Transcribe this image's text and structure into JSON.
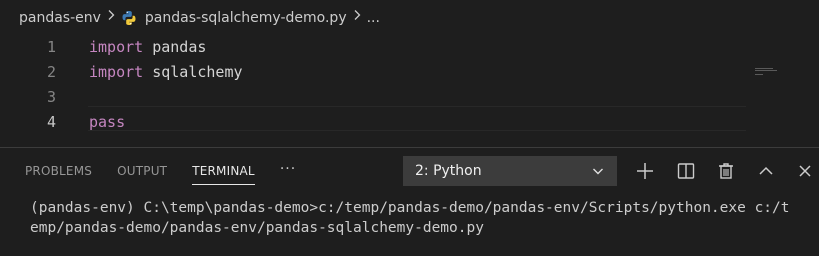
{
  "breadcrumb": {
    "folder": "pandas-env",
    "file": "pandas-sqlalchemy-demo.py",
    "more": "...",
    "separator": ">"
  },
  "editor": {
    "lines": [
      {
        "num": "1",
        "keyword": "import",
        "rest": " pandas"
      },
      {
        "num": "2",
        "keyword": "import",
        "rest": " sqlalchemy"
      },
      {
        "num": "3",
        "keyword": "",
        "rest": ""
      },
      {
        "num": "4",
        "keyword": "pass",
        "rest": ""
      }
    ]
  },
  "panel": {
    "tabs": [
      {
        "label": "PROBLEMS",
        "active": false
      },
      {
        "label": "OUTPUT",
        "active": false
      },
      {
        "label": "TERMINAL",
        "active": true
      }
    ],
    "more_label": "···",
    "terminal_select": {
      "value": "2: Python"
    },
    "actions": [
      "plus-icon",
      "split-terminal-icon",
      "trash-icon",
      "chevron-up-icon",
      "close-icon"
    ],
    "terminal_output": [
      "(pandas-env) C:\\temp\\pandas-demo>c:/temp/pandas-demo/pandas-env/Scripts/python.exe c:/t",
      "emp/pandas-demo/pandas-env/pandas-sqlalchemy-demo.py"
    ]
  },
  "colors": {
    "background": "#1e1e1e",
    "keyword": "#c586c0",
    "line_number": "#858585",
    "select_bg": "#3c3c3c"
  }
}
